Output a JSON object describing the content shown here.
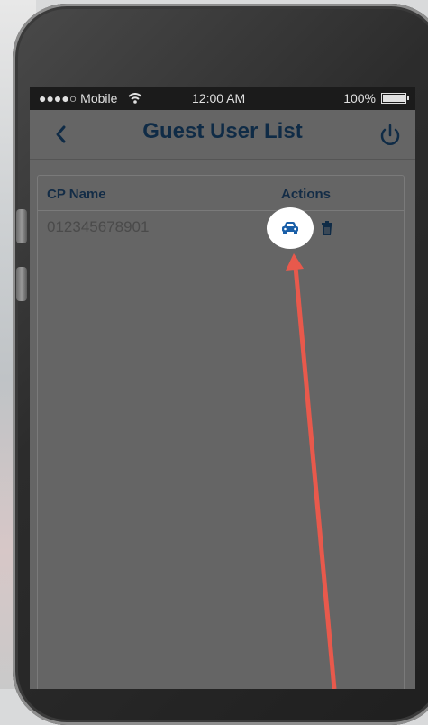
{
  "statusbar": {
    "carrier": "●●●●○ Mobile",
    "time": "12:00 AM",
    "battery": "100%"
  },
  "nav": {
    "title": "Guest User List",
    "back_icon": "chevron-left-icon",
    "power_icon": "power-icon"
  },
  "table": {
    "headers": [
      "CP Name",
      "Actions"
    ],
    "rows": [
      {
        "cp_name": "012345678901",
        "actions": [
          "car-icon",
          "trash-icon"
        ]
      }
    ]
  },
  "colors": {
    "title": "#0f2b46",
    "highlight": "#ffffff",
    "arrow": "#e8594c",
    "accent_icon": "#1a5fa8"
  }
}
